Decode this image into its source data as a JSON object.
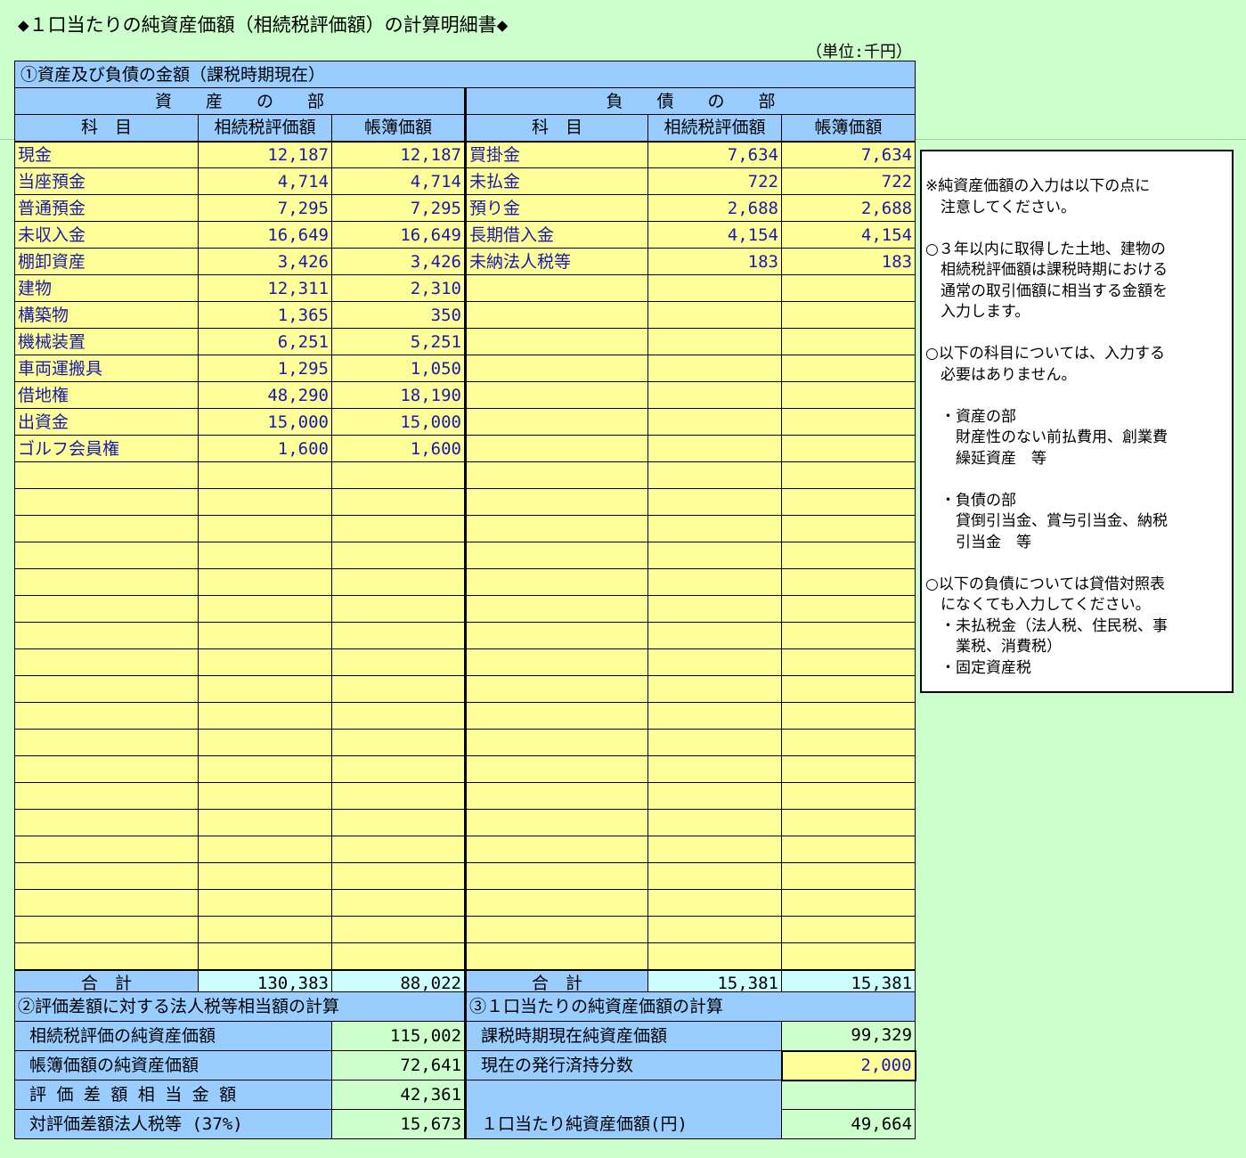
{
  "title": "◆１口当たりの純資産価額（相続税評価額）の計算明細書◆",
  "unit": "（単位:千円）",
  "section1": {
    "title": "①資産及び負債の金額（課税時期現在）",
    "assets_header": "資　　産　　の　　部",
    "liabilities_header": "負　　債　　の　　部",
    "col_subject": "科　目",
    "col_inheritance": "相続税評価額",
    "col_book": "帳簿価額",
    "rows": [
      {
        "a_name": "現金",
        "a_eval": "12,187",
        "a_book": "12,187",
        "l_name": "買掛金",
        "l_eval": "7,634",
        "l_book": "7,634"
      },
      {
        "a_name": "当座預金",
        "a_eval": "4,714",
        "a_book": "4,714",
        "l_name": "未払金",
        "l_eval": "722",
        "l_book": "722"
      },
      {
        "a_name": "普通預金",
        "a_eval": "7,295",
        "a_book": "7,295",
        "l_name": "預り金",
        "l_eval": "2,688",
        "l_book": "2,688"
      },
      {
        "a_name": "未収入金",
        "a_eval": "16,649",
        "a_book": "16,649",
        "l_name": "長期借入金",
        "l_eval": "4,154",
        "l_book": "4,154"
      },
      {
        "a_name": "棚卸資産",
        "a_eval": "3,426",
        "a_book": "3,426",
        "l_name": "未納法人税等",
        "l_eval": "183",
        "l_book": "183"
      },
      {
        "a_name": "建物",
        "a_eval": "12,311",
        "a_book": "2,310",
        "l_name": "",
        "l_eval": "",
        "l_book": ""
      },
      {
        "a_name": "構築物",
        "a_eval": "1,365",
        "a_book": "350",
        "l_name": "",
        "l_eval": "",
        "l_book": ""
      },
      {
        "a_name": "機械装置",
        "a_eval": "6,251",
        "a_book": "5,251",
        "l_name": "",
        "l_eval": "",
        "l_book": ""
      },
      {
        "a_name": "車両運搬具",
        "a_eval": "1,295",
        "a_book": "1,050",
        "l_name": "",
        "l_eval": "",
        "l_book": ""
      },
      {
        "a_name": "借地権",
        "a_eval": "48,290",
        "a_book": "18,190",
        "l_name": "",
        "l_eval": "",
        "l_book": ""
      },
      {
        "a_name": "出資金",
        "a_eval": "15,000",
        "a_book": "15,000",
        "l_name": "",
        "l_eval": "",
        "l_book": ""
      },
      {
        "a_name": "ゴルフ会員権",
        "a_eval": "1,600",
        "a_book": "1,600",
        "l_name": "",
        "l_eval": "",
        "l_book": ""
      },
      {
        "a_name": "",
        "a_eval": "",
        "a_book": "",
        "l_name": "",
        "l_eval": "",
        "l_book": ""
      },
      {
        "a_name": "",
        "a_eval": "",
        "a_book": "",
        "l_name": "",
        "l_eval": "",
        "l_book": ""
      },
      {
        "a_name": "",
        "a_eval": "",
        "a_book": "",
        "l_name": "",
        "l_eval": "",
        "l_book": ""
      },
      {
        "a_name": "",
        "a_eval": "",
        "a_book": "",
        "l_name": "",
        "l_eval": "",
        "l_book": ""
      },
      {
        "a_name": "",
        "a_eval": "",
        "a_book": "",
        "l_name": "",
        "l_eval": "",
        "l_book": ""
      },
      {
        "a_name": "",
        "a_eval": "",
        "a_book": "",
        "l_name": "",
        "l_eval": "",
        "l_book": ""
      },
      {
        "a_name": "",
        "a_eval": "",
        "a_book": "",
        "l_name": "",
        "l_eval": "",
        "l_book": ""
      },
      {
        "a_name": "",
        "a_eval": "",
        "a_book": "",
        "l_name": "",
        "l_eval": "",
        "l_book": ""
      },
      {
        "a_name": "",
        "a_eval": "",
        "a_book": "",
        "l_name": "",
        "l_eval": "",
        "l_book": ""
      },
      {
        "a_name": "",
        "a_eval": "",
        "a_book": "",
        "l_name": "",
        "l_eval": "",
        "l_book": ""
      },
      {
        "a_name": "",
        "a_eval": "",
        "a_book": "",
        "l_name": "",
        "l_eval": "",
        "l_book": ""
      },
      {
        "a_name": "",
        "a_eval": "",
        "a_book": "",
        "l_name": "",
        "l_eval": "",
        "l_book": ""
      },
      {
        "a_name": "",
        "a_eval": "",
        "a_book": "",
        "l_name": "",
        "l_eval": "",
        "l_book": ""
      },
      {
        "a_name": "",
        "a_eval": "",
        "a_book": "",
        "l_name": "",
        "l_eval": "",
        "l_book": ""
      },
      {
        "a_name": "",
        "a_eval": "",
        "a_book": "",
        "l_name": "",
        "l_eval": "",
        "l_book": ""
      },
      {
        "a_name": "",
        "a_eval": "",
        "a_book": "",
        "l_name": "",
        "l_eval": "",
        "l_book": ""
      },
      {
        "a_name": "",
        "a_eval": "",
        "a_book": "",
        "l_name": "",
        "l_eval": "",
        "l_book": ""
      },
      {
        "a_name": "",
        "a_eval": "",
        "a_book": "",
        "l_name": "",
        "l_eval": "",
        "l_book": ""
      },
      {
        "a_name": "",
        "a_eval": "",
        "a_book": "",
        "l_name": "",
        "l_eval": "",
        "l_book": ""
      }
    ],
    "total_label": "合　計",
    "assets_total_eval": "130,383",
    "assets_total_book": "88,022",
    "liabilities_total_eval": "15,381",
    "liabilities_total_book": "15,381"
  },
  "section2": {
    "title": "②評価差額に対する法人税等相当額の計算",
    "rows": [
      {
        "label": "相続税評価の純資産価額",
        "value": "115,002"
      },
      {
        "label": "帳簿価額の純資産価額",
        "value": "72,641"
      },
      {
        "label": "評 価 差 額 相 当 金 額",
        "value": "42,361"
      },
      {
        "label": "対評価差額法人税等 (37%)",
        "value": "15,673"
      }
    ]
  },
  "section3": {
    "title": "③１口当たりの純資産価額の計算",
    "net_assets_label": "課税時期現在純資産価額",
    "net_assets_value": "99,329",
    "shares_label": "現在の発行済持分数",
    "shares_value": "2,000",
    "per_share_label": "１口当たり純資産価額(円)",
    "per_share_value": "49,664"
  },
  "notes": {
    "lines": [
      "※純資産価額の入力は以下の点に",
      "　注意してください。",
      "",
      "○３年以内に取得した土地、建物の",
      "　相続税評価額は課税時期における",
      "　通常の取引価額に相当する金額を",
      "　入力します。",
      "",
      "○以下の科目については、入力する",
      "　必要はありません。",
      "",
      "　・資産の部",
      "　　財産性のない前払費用、創業費",
      "　　繰延資産　等",
      "",
      "　・負債の部",
      "　　貸倒引当金、賞与引当金、納税",
      "　　引当金　等",
      "",
      "○以下の負債については貸借対照表",
      "　になくても入力してください。",
      "　・未払税金（法人税、住民税、事",
      "　　業税、消費税）",
      "　・固定資産税"
    ]
  }
}
